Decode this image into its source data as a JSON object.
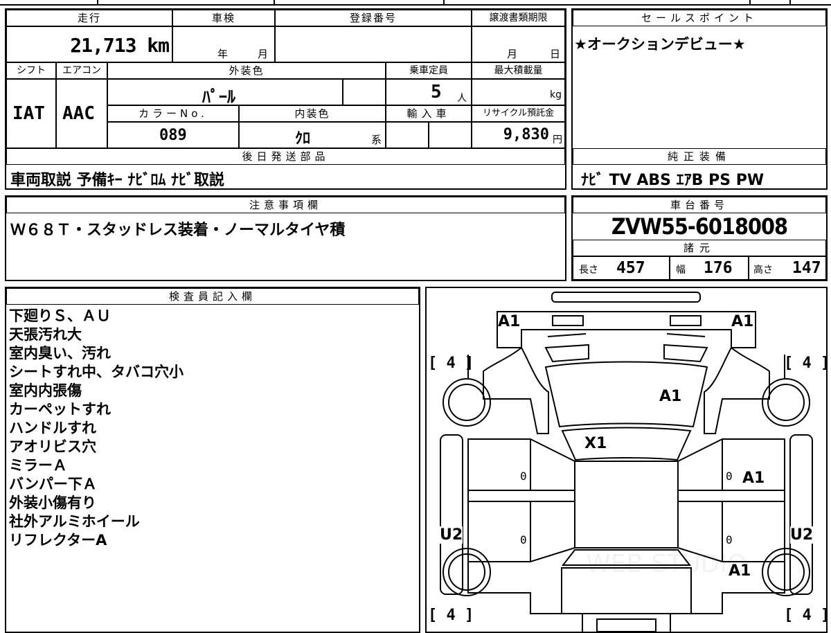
{
  "top_summary": {
    "headers": {
      "mileage": "走行",
      "inspection": "車検",
      "registration": "登録番号",
      "transfer_deadline": "譲渡書類期限"
    },
    "mileage_value": "21,713 km",
    "inspection_year": "年",
    "inspection_month": "月",
    "transfer_month": "月",
    "transfer_day": "日"
  },
  "specs": {
    "headers": {
      "shift": "シフト",
      "aircon": "エアコン",
      "exterior_color": "外装色",
      "capacity": "乗車定員",
      "max_load": "最大積載量",
      "color_no": "カラーNo.",
      "interior_color": "内装色",
      "import": "輸入車",
      "recycle_fee": "リサイクル預託金"
    },
    "shift": "IAT",
    "aircon": "AAC",
    "exterior_color": "ﾊﾟｰﾙ",
    "capacity_value": "5",
    "capacity_unit": "人",
    "load_unit": "kg",
    "color_no": "089",
    "interior_color": "ｸﾛ",
    "interior_suffix": "系",
    "recycle_value": "9,830",
    "recycle_unit": "円"
  },
  "deferred_parts": {
    "header": "後日発送部品",
    "value": "車両取説 予備ｷｰ ﾅﾋﾞﾛﾑ ﾅﾋﾞ取説"
  },
  "sales_point": {
    "header": "セールスポイント",
    "value": "★オークションデビュー★"
  },
  "genuine_equipment": {
    "header": "純正装備",
    "value": "ﾅﾋﾞ TV ABS ｴｱB PS PW"
  },
  "notes": {
    "header": "注意事項欄",
    "value": "Ｗ６８Ｔ・スタッドレス装着・ノーマルタイヤ積"
  },
  "chassis": {
    "header": "車台番号",
    "value": "ZVW55-6018008"
  },
  "dimensions": {
    "header": "諸元",
    "length_label": "長さ",
    "length": "457",
    "width_label": "幅",
    "width": "176",
    "height_label": "高さ",
    "height": "147"
  },
  "inspector": {
    "header": "検査員記入欄",
    "lines": [
      "下廻りＳ、ＡＵ",
      "天張汚れ大",
      "室内臭い、汚れ",
      "シートすれ中、タバコ穴小",
      "室内内張傷",
      "カーペットすれ",
      "ハンドルすれ",
      "アオリビス穴",
      "ミラーＡ",
      "バンパー下Ａ",
      "外装小傷有り",
      "社外アルミホイール",
      "リフレクターA"
    ]
  },
  "diagram": {
    "marks": {
      "front_left": "A1",
      "front_right": "A1",
      "hood": "A1",
      "windshield": "X1",
      "right_front_door": "A1",
      "right_rear": "A1",
      "left_side": "U2",
      "right_side": "U2"
    },
    "tires": {
      "front_left": "[ 4 ]",
      "front_right": "[ 4 ]",
      "rear_left": "[ 4 ]",
      "rear_right": "[ 4 ]"
    },
    "zeros": [
      "0",
      "0",
      "0",
      "0"
    ],
    "watermark": "WEB STUDIO"
  }
}
